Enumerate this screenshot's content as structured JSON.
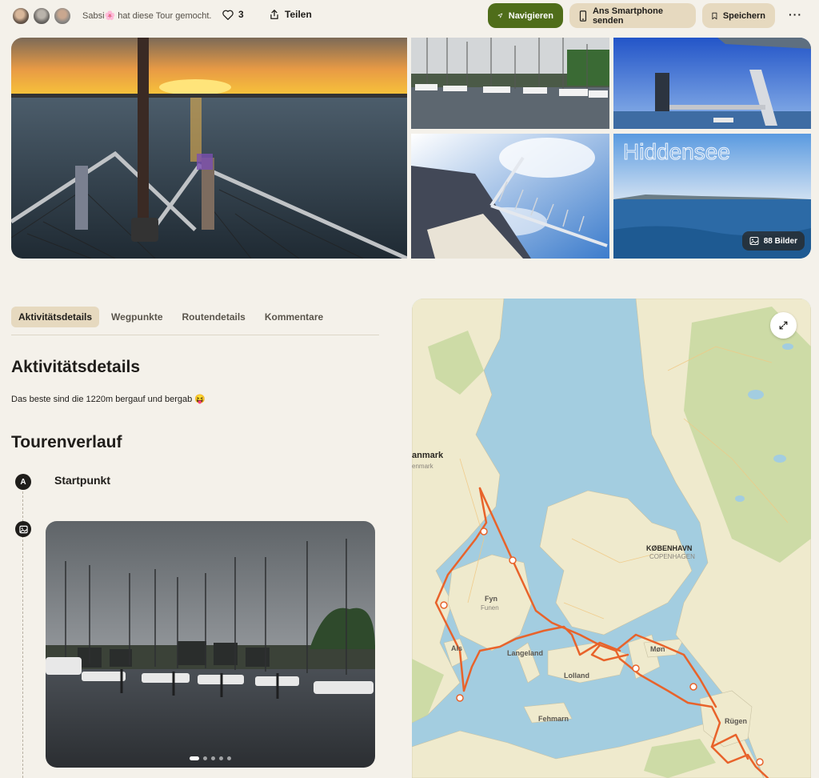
{
  "header": {
    "liked_by": "Sabsi🌸 hat diese Tour gemocht.",
    "like_count": "3",
    "share_label": "Teilen",
    "navigate_label": "Navigieren",
    "send_phone_label": "Ans Smartphone senden",
    "save_label": "Speichern",
    "more_label": "···"
  },
  "gallery": {
    "image_count": "88 Bilder",
    "watermark": "Hiddensee"
  },
  "tabs": [
    {
      "label": "Aktivitätsdetails",
      "active": true
    },
    {
      "label": "Wegpunkte",
      "active": false
    },
    {
      "label": "Routendetails",
      "active": false
    },
    {
      "label": "Kommentare",
      "active": false
    }
  ],
  "details": {
    "heading": "Aktivitätsdetails",
    "description": "Das beste sind die 1220m bergauf und bergab 😝"
  },
  "route": {
    "heading": "Tourenverlauf",
    "start_marker": "A",
    "start_label": "Startpunkt"
  },
  "map": {
    "labels": {
      "denmark": "anmark",
      "denmark_sub": "enmark",
      "copenhagen": "KØBENHAVN",
      "copenhagen_sub": "COPENHAGEN",
      "fyn": "Fyn",
      "fyn_sub": "Funen",
      "als": "Als",
      "langeland": "Langeland",
      "lolland": "Lolland",
      "mon": "Møn",
      "fehmarn": "Fehmarn",
      "rugen": "Rügen"
    },
    "colors": {
      "route": "#e8632b",
      "water": "#a3cde0",
      "land": "#efeacd",
      "forest": "#c9d9a2"
    }
  }
}
